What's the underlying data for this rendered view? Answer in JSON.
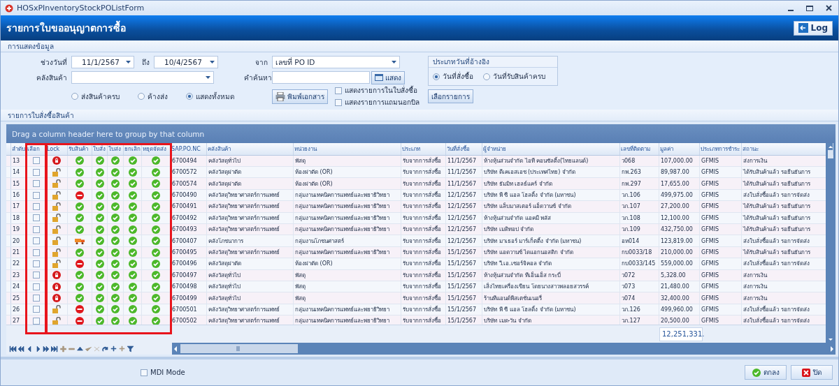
{
  "window": {
    "title": "HOSxPInventoryStockPOListForm"
  },
  "header": {
    "title": "รายการใบขออนุญาตการซื้อ",
    "log_button": "Log"
  },
  "filter_section": {
    "title": "การแสดงข้อมูล",
    "date_range_label": "ช่วงวันที่",
    "date_from": "11/1/2567",
    "to_label": "ถึง",
    "date_to": "10/4/2567",
    "source_label": "จาก",
    "source": "เลขที่ PO ID",
    "warehouse_label": "คลังสินค้า",
    "search_label": "คำค้นหา",
    "show_button": "แสดง",
    "delivery_filter": [
      {
        "label": "ส่งสินค้าครบ",
        "selected": false
      },
      {
        "label": "ค้างส่ง",
        "selected": false
      },
      {
        "label": "แสดงทั้งหมด",
        "selected": true
      }
    ],
    "print_button": "พิมพ์เอกสาร",
    "options": [
      {
        "label": "แสดงรายการในใบสั่งซื้อ",
        "checked": false
      },
      {
        "label": "แสดงรายการแถมนอกบิล",
        "checked": false
      }
    ],
    "date_type": {
      "title": "ประเภทวันที่อ้างอิง",
      "options": [
        {
          "label": "วันที่สั่งซื้อ",
          "selected": true
        },
        {
          "label": "วันที่รับสินค้าครบ",
          "selected": false
        }
      ]
    },
    "select_button": "เลือกรายการ"
  },
  "list_section": {
    "title": "รายการใบสั่งซื้อสินค้า"
  },
  "grid": {
    "group_hint": "Drag a column header here to group by that column",
    "columns": [
      {
        "label": "ลำดับ",
        "kind": "text"
      },
      {
        "label": "เลือก",
        "kind": "check"
      },
      {
        "label": "Lock",
        "kind": "icon"
      },
      {
        "label": "รับสินค้า",
        "kind": "icon"
      },
      {
        "label": "ใบสั่ง",
        "kind": "icon"
      },
      {
        "label": "ใบส่ง",
        "kind": "icon"
      },
      {
        "label": "ยกเลิก",
        "kind": "icon"
      },
      {
        "label": "หยุดจัดส่ง",
        "kind": "icon"
      },
      {
        "label": "SAP.PO.NC",
        "kind": "text"
      },
      {
        "label": "คลังสินค้า",
        "kind": "text"
      },
      {
        "label": "หน่วยงาน",
        "kind": "text"
      },
      {
        "label": "ประเภท",
        "kind": "text"
      },
      {
        "label": "วันที่สั่งซื้อ",
        "kind": "text"
      },
      {
        "label": "ผู้จำหน่าย",
        "kind": "text"
      },
      {
        "label": "เลขที่ติดตาม",
        "kind": "text"
      },
      {
        "label": "มูลค่า",
        "kind": "text"
      },
      {
        "label": "ประเภทการชำระ",
        "kind": "text"
      },
      {
        "label": "สถานะ",
        "kind": "text"
      }
    ],
    "rows": [
      {
        "cells": [
          "13",
          {
            "checked": false
          },
          {
            "kind": "locked"
          },
          {
            "kind": "ok"
          },
          {
            "kind": "ok"
          },
          {
            "kind": "ok"
          },
          {
            "kind": "ok"
          },
          {
            "kind": "ok"
          },
          "6700494",
          "คลังวัสดุทั่วไป",
          "พัสดุ",
          "รับจากการสั่งซื้อ",
          "11/1/2567",
          "ห้างหุ้นส่วนจำกัด ไอที คอนซัลติ้ง(ไทยแลนด์)",
          "ว068",
          "107,000.00",
          "GFMIS",
          "ส่งการเงิน"
        ]
      },
      {
        "cells": [
          "14",
          {
            "checked": false
          },
          {
            "kind": "unlocked"
          },
          {
            "kind": "ok"
          },
          {
            "kind": "ok"
          },
          {
            "kind": "ok"
          },
          {
            "kind": "ok"
          },
          {
            "kind": "ok"
          },
          "6700572",
          "คลังวัสดุผ่าตัด",
          "ห้องผ่าตัด (OR)",
          "รับจากการสั่งซื้อ",
          "11/1/2567",
          "บริษัท ดีเคเอสเอช (ประเทศไทย) จำกัด",
          "กพ.263",
          "89,987.00",
          "GFMIS",
          "ได้รับสินค้าแล้ว รอยืนยันการ"
        ]
      },
      {
        "cells": [
          "15",
          {
            "checked": false
          },
          {
            "kind": "unlocked"
          },
          {
            "kind": "ok"
          },
          {
            "kind": "ok"
          },
          {
            "kind": "ok"
          },
          {
            "kind": "ok"
          },
          {
            "kind": "ok"
          },
          "6700574",
          "คลังวัสดุผ่าตัด",
          "ห้องผ่าตัด (OR)",
          "รับจากการสั่งซื้อ",
          "11/1/2567",
          "บริษัท ธัมมิท เฮลธ์แคร์ จำกัด",
          "กพ.297",
          "17,655.00",
          "GFMIS",
          "ได้รับสินค้าแล้ว รอยืนยันการ"
        ]
      },
      {
        "cells": [
          "16",
          {
            "checked": false
          },
          {
            "kind": "unlocked"
          },
          {
            "kind": "stop"
          },
          {
            "kind": "ok"
          },
          {
            "kind": "ok"
          },
          {
            "kind": "ok"
          },
          {
            "kind": "ok"
          },
          "6700490",
          "คลังวัสดุวิทยาศาสตร์การแพทย์",
          "กลุ่มงานเทคนิคการแพทย์และพยาธิวิทยา",
          "รับจากการสั่งซื้อ",
          "12/1/2567",
          "บริษัท พี ซี แอล โฮลดิ้ง จำกัด (มหาชน)",
          "วภ.106",
          "499,975.00",
          "GFMIS",
          "ส่งใบสั่งซื้อแล้ว รอการจัดส่ง"
        ]
      },
      {
        "cells": [
          "17",
          {
            "checked": false
          },
          {
            "kind": "unlocked"
          },
          {
            "kind": "ok"
          },
          {
            "kind": "ok"
          },
          {
            "kind": "ok"
          },
          {
            "kind": "ok"
          },
          {
            "kind": "ok"
          },
          "6700491",
          "คลังวัสดุวิทยาศาสตร์การแพทย์",
          "กลุ่มงานเทคนิคการแพทย์และพยาธิวิทยา",
          "รับจากการสั่งซื้อ",
          "12/1/2567",
          "บริษัท แล็บมาสเตอร์ แอ็ดวานซ์ จำกัด",
          "วภ.107",
          "27,200.00",
          "GFMIS",
          "ได้รับสินค้าแล้ว รอยืนยันการ"
        ]
      },
      {
        "cells": [
          "18",
          {
            "checked": false
          },
          {
            "kind": "unlocked"
          },
          {
            "kind": "ok"
          },
          {
            "kind": "ok"
          },
          {
            "kind": "ok"
          },
          {
            "kind": "ok"
          },
          {
            "kind": "ok"
          },
          "6700492",
          "คลังวัสดุวิทยาศาสตร์การแพทย์",
          "กลุ่มงานเทคนิคการแพทย์และพยาธิวิทยา",
          "รับจากการสั่งซื้อ",
          "12/1/2567",
          "ห้างหุ้นส่วนจำกัด แอคมี พลัส",
          "วภ.108",
          "12,100.00",
          "GFMIS",
          "ได้รับสินค้าแล้ว รอยืนยันการ"
        ]
      },
      {
        "cells": [
          "19",
          {
            "checked": false
          },
          {
            "kind": "unlocked"
          },
          {
            "kind": "ok"
          },
          {
            "kind": "ok"
          },
          {
            "kind": "ok"
          },
          {
            "kind": "ok"
          },
          {
            "kind": "ok"
          },
          "6700493",
          "คลังวัสดุวิทยาศาสตร์การแพทย์",
          "กลุ่มงานเทคนิคการแพทย์และพยาธิวิทยา",
          "รับจากการสั่งซื้อ",
          "12/1/2567",
          "บริษัท เมดิทอป จำกัด",
          "วภ.109",
          "432,750.00",
          "GFMIS",
          "ได้รับสินค้าแล้ว รอยืนยันการ"
        ]
      },
      {
        "cells": [
          "20",
          {
            "checked": false
          },
          {
            "kind": "unlocked"
          },
          {
            "kind": "truck"
          },
          {
            "kind": "ok"
          },
          {
            "kind": "ok"
          },
          {
            "kind": "ok"
          },
          {
            "kind": "ok"
          },
          "6700407",
          "คลังโภชนาการ",
          "กลุ่มงานโภชนศาสตร์",
          "รับจากการสั่งซื้อ",
          "12/1/2567",
          "บริษัท มาเธอร์ มาร์เก็ตติ้ง จำกัด (มหาชน)",
          "อห014",
          "123,819.00",
          "GFMIS",
          "ส่งใบสั่งซื้อแล้ว รอการจัดส่ง"
        ]
      },
      {
        "cells": [
          "21",
          {
            "checked": false
          },
          {
            "kind": "unlocked"
          },
          {
            "kind": "ok"
          },
          {
            "kind": "ok"
          },
          {
            "kind": "ok"
          },
          {
            "kind": "ok"
          },
          {
            "kind": "ok"
          },
          "6700495",
          "คลังวัสดุวิทยาศาสตร์การแพทย์",
          "กลุ่มงานเทคนิคการแพทย์และพยาธิวิทยา",
          "รับจากการสั่งซื้อ",
          "15/1/2567",
          "บริษัท แอดวานซ์ ไดแอกนอสติก จำกัด",
          "กบ0033/18",
          "210,000.00",
          "GFMIS",
          "ได้รับสินค้าแล้ว รอยืนยันการ"
        ]
      },
      {
        "cells": [
          "22",
          {
            "checked": false
          },
          {
            "kind": "unlocked"
          },
          {
            "kind": "stop"
          },
          {
            "kind": "ok"
          },
          {
            "kind": "ok"
          },
          {
            "kind": "ok"
          },
          {
            "kind": "ok"
          },
          "6700496",
          "คลังวัสดุผ่าตัด",
          "ห้องผ่าตัด (OR)",
          "รับจากการสั่งซื้อ",
          "15/1/2567",
          "บริษัท วี.เอ.เซอร์จิคอล จำกัด",
          "กบ0033/145",
          "559,000.00",
          "GFMIS",
          "ส่งใบสั่งซื้อแล้ว รอการจัดส่ง"
        ]
      },
      {
        "cells": [
          "23",
          {
            "checked": false
          },
          {
            "kind": "locked"
          },
          {
            "kind": "ok"
          },
          {
            "kind": "ok"
          },
          {
            "kind": "ok"
          },
          {
            "kind": "ok"
          },
          {
            "kind": "ok"
          },
          "6700497",
          "คลังวัสดุทั่วไป",
          "พัสดุ",
          "รับจากการสั่งซื้อ",
          "15/1/2567",
          "ห้างหุ้นส่วนจำกัด ทีเอ็นเอ็ส กระบี่",
          "ว072",
          "5,328.00",
          "GFMIS",
          "ส่งการเงิน"
        ]
      },
      {
        "cells": [
          "24",
          {
            "checked": false
          },
          {
            "kind": "locked"
          },
          {
            "kind": "ok"
          },
          {
            "kind": "ok"
          },
          {
            "kind": "ok"
          },
          {
            "kind": "ok"
          },
          {
            "kind": "ok"
          },
          "6700498",
          "คลังวัสดุทั่วไป",
          "พัสดุ",
          "รับจากการสั่งซื้อ",
          "15/1/2567",
          "เส็งไทยเครื่องเขียน โดยนางสาวพลอยสวรรค์",
          "ว073",
          "21,480.00",
          "GFMIS",
          "ส่งการเงิน"
        ]
      },
      {
        "cells": [
          "25",
          {
            "checked": false
          },
          {
            "kind": "locked"
          },
          {
            "kind": "ok"
          },
          {
            "kind": "ok"
          },
          {
            "kind": "ok"
          },
          {
            "kind": "ok"
          },
          {
            "kind": "ok"
          },
          "6700499",
          "คลังวัสดุทั่วไป",
          "พัสดุ",
          "รับจากการสั่งซื้อ",
          "15/1/2567",
          "ร้านทีแอนด์พีสเตชั่นเนอรี่",
          "ว074",
          "32,400.00",
          "GFMIS",
          "ส่งการเงิน"
        ]
      },
      {
        "cells": [
          "26",
          {
            "checked": false
          },
          {
            "kind": "unlocked"
          },
          {
            "kind": "stop"
          },
          {
            "kind": "ok"
          },
          {
            "kind": "ok"
          },
          {
            "kind": "ok"
          },
          {
            "kind": "ok"
          },
          "6700501",
          "คลังวัสดุวิทยาศาสตร์การแพทย์",
          "กลุ่มงานเทคนิคการแพทย์และพยาธิวิทยา",
          "รับจากการสั่งซื้อ",
          "15/1/2567",
          "บริษัท พี ซี แอล โฮลดิ้ง จำกัด (มหาชน)",
          "วภ.126",
          "499,960.00",
          "GFMIS",
          "ส่งใบสั่งซื้อแล้ว รอการจัดส่ง"
        ]
      },
      {
        "cells": [
          "27",
          {
            "checked": false
          },
          {
            "kind": "unlocked"
          },
          {
            "kind": "stop"
          },
          {
            "kind": "ok"
          },
          {
            "kind": "ok"
          },
          {
            "kind": "ok"
          },
          {
            "kind": "ok"
          },
          "6700502",
          "คลังวัสดุวิทยาศาสตร์การแพทย์",
          "กลุ่มงานเทคนิคการแพทย์และพยาธิวิทยา",
          "รับจากการสั่งซื้อ",
          "15/1/2567",
          "บริษัท เมด-วัน จำกัด",
          "วภ.127",
          "20,500.00",
          "GFMIS",
          "ส่งใบสั่งซื้อแล้ว รอการจัดส่ง"
        ]
      }
    ],
    "total": "12,251,331."
  },
  "bottom": {
    "mdi_mode": {
      "label": "MDI Mode",
      "checked": false
    },
    "ok_button": "ตกลง",
    "close_button": "ปิด"
  }
}
